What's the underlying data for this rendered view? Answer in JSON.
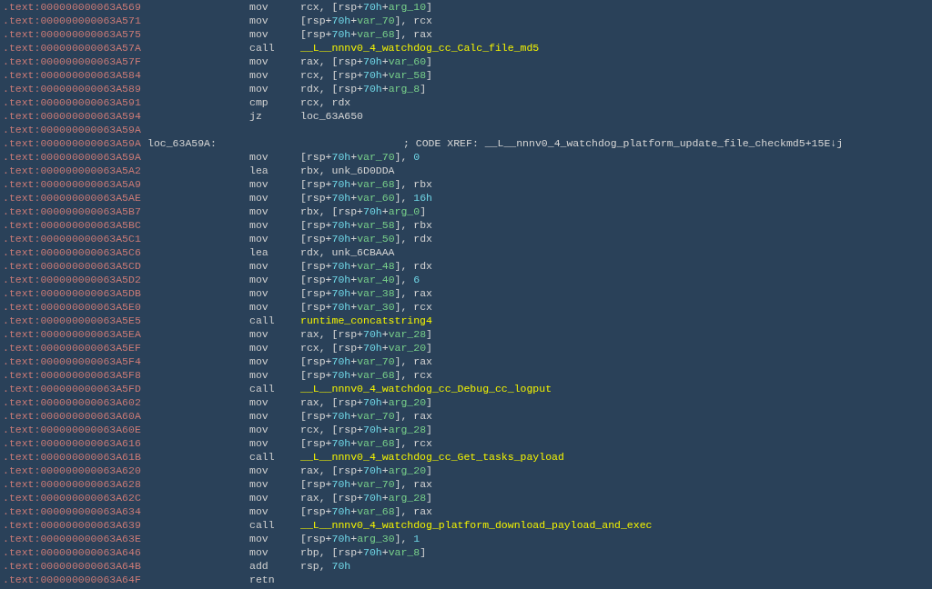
{
  "listing": [
    {
      "address": ".text:000000000063A569",
      "mnemonic": "mov",
      "operand": [
        {
          "kind": "plain",
          "text": "rcx, [rsp+"
        },
        {
          "kind": "number",
          "text": "70h"
        },
        {
          "kind": "plain",
          "text": "+"
        },
        {
          "kind": "variable",
          "text": "arg_10"
        },
        {
          "kind": "plain",
          "text": "]"
        }
      ]
    },
    {
      "address": ".text:000000000063A571",
      "mnemonic": "mov",
      "operand": [
        {
          "kind": "plain",
          "text": "[rsp+"
        },
        {
          "kind": "number",
          "text": "70h"
        },
        {
          "kind": "plain",
          "text": "+"
        },
        {
          "kind": "variable",
          "text": "var_70"
        },
        {
          "kind": "plain",
          "text": "], rcx"
        }
      ]
    },
    {
      "address": ".text:000000000063A575",
      "mnemonic": "mov",
      "operand": [
        {
          "kind": "plain",
          "text": "[rsp+"
        },
        {
          "kind": "number",
          "text": "70h"
        },
        {
          "kind": "plain",
          "text": "+"
        },
        {
          "kind": "variable",
          "text": "var_68"
        },
        {
          "kind": "plain",
          "text": "], rax"
        }
      ]
    },
    {
      "address": ".text:000000000063A57A",
      "mnemonic": "call",
      "operand": [
        {
          "kind": "function",
          "text": "__L__nnnv0_4_watchdog_cc_Calc_file_md5"
        }
      ]
    },
    {
      "address": ".text:000000000063A57F",
      "mnemonic": "mov",
      "operand": [
        {
          "kind": "plain",
          "text": "rax, [rsp+"
        },
        {
          "kind": "number",
          "text": "70h"
        },
        {
          "kind": "plain",
          "text": "+"
        },
        {
          "kind": "variable",
          "text": "var_60"
        },
        {
          "kind": "plain",
          "text": "]"
        }
      ]
    },
    {
      "address": ".text:000000000063A584",
      "mnemonic": "mov",
      "operand": [
        {
          "kind": "plain",
          "text": "rcx, [rsp+"
        },
        {
          "kind": "number",
          "text": "70h"
        },
        {
          "kind": "plain",
          "text": "+"
        },
        {
          "kind": "variable",
          "text": "var_58"
        },
        {
          "kind": "plain",
          "text": "]"
        }
      ]
    },
    {
      "address": ".text:000000000063A589",
      "mnemonic": "mov",
      "operand": [
        {
          "kind": "plain",
          "text": "rdx, [rsp+"
        },
        {
          "kind": "number",
          "text": "70h"
        },
        {
          "kind": "plain",
          "text": "+"
        },
        {
          "kind": "variable",
          "text": "arg_8"
        },
        {
          "kind": "plain",
          "text": "]"
        }
      ]
    },
    {
      "address": ".text:000000000063A591",
      "mnemonic": "cmp",
      "operand": [
        {
          "kind": "plain",
          "text": "rcx, rdx"
        }
      ]
    },
    {
      "address": ".text:000000000063A594",
      "mnemonic": "jz",
      "operand": [
        {
          "kind": "plain",
          "text": "loc_63A650"
        }
      ]
    },
    {
      "address": ".text:000000000063A59A"
    },
    {
      "address": ".text:000000000063A59A",
      "label": "loc_63A59A:",
      "comment": "; CODE XREF: __L__nnnv0_4_watchdog_platform_update_file_checkmd5+15E↓j"
    },
    {
      "address": ".text:000000000063A59A",
      "mnemonic": "mov",
      "operand": [
        {
          "kind": "plain",
          "text": "[rsp+"
        },
        {
          "kind": "number",
          "text": "70h"
        },
        {
          "kind": "plain",
          "text": "+"
        },
        {
          "kind": "variable",
          "text": "var_70"
        },
        {
          "kind": "plain",
          "text": "], "
        },
        {
          "kind": "number",
          "text": "0"
        }
      ]
    },
    {
      "address": ".text:000000000063A5A2",
      "mnemonic": "lea",
      "operand": [
        {
          "kind": "plain",
          "text": "rbx, unk_6D0DDA"
        }
      ]
    },
    {
      "address": ".text:000000000063A5A9",
      "mnemonic": "mov",
      "operand": [
        {
          "kind": "plain",
          "text": "[rsp+"
        },
        {
          "kind": "number",
          "text": "70h"
        },
        {
          "kind": "plain",
          "text": "+"
        },
        {
          "kind": "variable",
          "text": "var_68"
        },
        {
          "kind": "plain",
          "text": "], rbx"
        }
      ]
    },
    {
      "address": ".text:000000000063A5AE",
      "mnemonic": "mov",
      "operand": [
        {
          "kind": "plain",
          "text": "[rsp+"
        },
        {
          "kind": "number",
          "text": "70h"
        },
        {
          "kind": "plain",
          "text": "+"
        },
        {
          "kind": "variable",
          "text": "var_60"
        },
        {
          "kind": "plain",
          "text": "], "
        },
        {
          "kind": "number",
          "text": "16h"
        }
      ]
    },
    {
      "address": ".text:000000000063A5B7",
      "mnemonic": "mov",
      "operand": [
        {
          "kind": "plain",
          "text": "rbx, [rsp+"
        },
        {
          "kind": "number",
          "text": "70h"
        },
        {
          "kind": "plain",
          "text": "+"
        },
        {
          "kind": "variable",
          "text": "arg_0"
        },
        {
          "kind": "plain",
          "text": "]"
        }
      ]
    },
    {
      "address": ".text:000000000063A5BC",
      "mnemonic": "mov",
      "operand": [
        {
          "kind": "plain",
          "text": "[rsp+"
        },
        {
          "kind": "number",
          "text": "70h"
        },
        {
          "kind": "plain",
          "text": "+"
        },
        {
          "kind": "variable",
          "text": "var_58"
        },
        {
          "kind": "plain",
          "text": "], rbx"
        }
      ]
    },
    {
      "address": ".text:000000000063A5C1",
      "mnemonic": "mov",
      "operand": [
        {
          "kind": "plain",
          "text": "[rsp+"
        },
        {
          "kind": "number",
          "text": "70h"
        },
        {
          "kind": "plain",
          "text": "+"
        },
        {
          "kind": "variable",
          "text": "var_50"
        },
        {
          "kind": "plain",
          "text": "], rdx"
        }
      ]
    },
    {
      "address": ".text:000000000063A5C6",
      "mnemonic": "lea",
      "operand": [
        {
          "kind": "plain",
          "text": "rdx, unk_6CBAAA"
        }
      ]
    },
    {
      "address": ".text:000000000063A5CD",
      "mnemonic": "mov",
      "operand": [
        {
          "kind": "plain",
          "text": "[rsp+"
        },
        {
          "kind": "number",
          "text": "70h"
        },
        {
          "kind": "plain",
          "text": "+"
        },
        {
          "kind": "variable",
          "text": "var_48"
        },
        {
          "kind": "plain",
          "text": "], rdx"
        }
      ]
    },
    {
      "address": ".text:000000000063A5D2",
      "mnemonic": "mov",
      "operand": [
        {
          "kind": "plain",
          "text": "[rsp+"
        },
        {
          "kind": "number",
          "text": "70h"
        },
        {
          "kind": "plain",
          "text": "+"
        },
        {
          "kind": "variable",
          "text": "var_40"
        },
        {
          "kind": "plain",
          "text": "], "
        },
        {
          "kind": "number",
          "text": "6"
        }
      ]
    },
    {
      "address": ".text:000000000063A5DB",
      "mnemonic": "mov",
      "operand": [
        {
          "kind": "plain",
          "text": "[rsp+"
        },
        {
          "kind": "number",
          "text": "70h"
        },
        {
          "kind": "plain",
          "text": "+"
        },
        {
          "kind": "variable",
          "text": "var_38"
        },
        {
          "kind": "plain",
          "text": "], rax"
        }
      ]
    },
    {
      "address": ".text:000000000063A5E0",
      "mnemonic": "mov",
      "operand": [
        {
          "kind": "plain",
          "text": "[rsp+"
        },
        {
          "kind": "number",
          "text": "70h"
        },
        {
          "kind": "plain",
          "text": "+"
        },
        {
          "kind": "variable",
          "text": "var_30"
        },
        {
          "kind": "plain",
          "text": "], rcx"
        }
      ]
    },
    {
      "address": ".text:000000000063A5E5",
      "mnemonic": "call",
      "operand": [
        {
          "kind": "function",
          "text": "runtime_concatstring4"
        }
      ]
    },
    {
      "address": ".text:000000000063A5EA",
      "mnemonic": "mov",
      "operand": [
        {
          "kind": "plain",
          "text": "rax, [rsp+"
        },
        {
          "kind": "number",
          "text": "70h"
        },
        {
          "kind": "plain",
          "text": "+"
        },
        {
          "kind": "variable",
          "text": "var_28"
        },
        {
          "kind": "plain",
          "text": "]"
        }
      ]
    },
    {
      "address": ".text:000000000063A5EF",
      "mnemonic": "mov",
      "operand": [
        {
          "kind": "plain",
          "text": "rcx, [rsp+"
        },
        {
          "kind": "number",
          "text": "70h"
        },
        {
          "kind": "plain",
          "text": "+"
        },
        {
          "kind": "variable",
          "text": "var_20"
        },
        {
          "kind": "plain",
          "text": "]"
        }
      ]
    },
    {
      "address": ".text:000000000063A5F4",
      "mnemonic": "mov",
      "operand": [
        {
          "kind": "plain",
          "text": "[rsp+"
        },
        {
          "kind": "number",
          "text": "70h"
        },
        {
          "kind": "plain",
          "text": "+"
        },
        {
          "kind": "variable",
          "text": "var_70"
        },
        {
          "kind": "plain",
          "text": "], rax"
        }
      ]
    },
    {
      "address": ".text:000000000063A5F8",
      "mnemonic": "mov",
      "operand": [
        {
          "kind": "plain",
          "text": "[rsp+"
        },
        {
          "kind": "number",
          "text": "70h"
        },
        {
          "kind": "plain",
          "text": "+"
        },
        {
          "kind": "variable",
          "text": "var_68"
        },
        {
          "kind": "plain",
          "text": "], rcx"
        }
      ]
    },
    {
      "address": ".text:000000000063A5FD",
      "mnemonic": "call",
      "operand": [
        {
          "kind": "function",
          "text": "__L__nnnv0_4_watchdog_cc_Debug_cc_logput"
        }
      ]
    },
    {
      "address": ".text:000000000063A602",
      "mnemonic": "mov",
      "operand": [
        {
          "kind": "plain",
          "text": "rax, [rsp+"
        },
        {
          "kind": "number",
          "text": "70h"
        },
        {
          "kind": "plain",
          "text": "+"
        },
        {
          "kind": "variable",
          "text": "arg_20"
        },
        {
          "kind": "plain",
          "text": "]"
        }
      ]
    },
    {
      "address": ".text:000000000063A60A",
      "mnemonic": "mov",
      "operand": [
        {
          "kind": "plain",
          "text": "[rsp+"
        },
        {
          "kind": "number",
          "text": "70h"
        },
        {
          "kind": "plain",
          "text": "+"
        },
        {
          "kind": "variable",
          "text": "var_70"
        },
        {
          "kind": "plain",
          "text": "], rax"
        }
      ]
    },
    {
      "address": ".text:000000000063A60E",
      "mnemonic": "mov",
      "operand": [
        {
          "kind": "plain",
          "text": "rcx, [rsp+"
        },
        {
          "kind": "number",
          "text": "70h"
        },
        {
          "kind": "plain",
          "text": "+"
        },
        {
          "kind": "variable",
          "text": "arg_28"
        },
        {
          "kind": "plain",
          "text": "]"
        }
      ]
    },
    {
      "address": ".text:000000000063A616",
      "mnemonic": "mov",
      "operand": [
        {
          "kind": "plain",
          "text": "[rsp+"
        },
        {
          "kind": "number",
          "text": "70h"
        },
        {
          "kind": "plain",
          "text": "+"
        },
        {
          "kind": "variable",
          "text": "var_68"
        },
        {
          "kind": "plain",
          "text": "], rcx"
        }
      ]
    },
    {
      "address": ".text:000000000063A61B",
      "mnemonic": "call",
      "operand": [
        {
          "kind": "function",
          "text": "__L__nnnv0_4_watchdog_cc_Get_tasks_payload"
        }
      ]
    },
    {
      "address": ".text:000000000063A620",
      "mnemonic": "mov",
      "operand": [
        {
          "kind": "plain",
          "text": "rax, [rsp+"
        },
        {
          "kind": "number",
          "text": "70h"
        },
        {
          "kind": "plain",
          "text": "+"
        },
        {
          "kind": "variable",
          "text": "arg_20"
        },
        {
          "kind": "plain",
          "text": "]"
        }
      ]
    },
    {
      "address": ".text:000000000063A628",
      "mnemonic": "mov",
      "operand": [
        {
          "kind": "plain",
          "text": "[rsp+"
        },
        {
          "kind": "number",
          "text": "70h"
        },
        {
          "kind": "plain",
          "text": "+"
        },
        {
          "kind": "variable",
          "text": "var_70"
        },
        {
          "kind": "plain",
          "text": "], rax"
        }
      ]
    },
    {
      "address": ".text:000000000063A62C",
      "mnemonic": "mov",
      "operand": [
        {
          "kind": "plain",
          "text": "rax, [rsp+"
        },
        {
          "kind": "number",
          "text": "70h"
        },
        {
          "kind": "plain",
          "text": "+"
        },
        {
          "kind": "variable",
          "text": "arg_28"
        },
        {
          "kind": "plain",
          "text": "]"
        }
      ]
    },
    {
      "address": ".text:000000000063A634",
      "mnemonic": "mov",
      "operand": [
        {
          "kind": "plain",
          "text": "[rsp+"
        },
        {
          "kind": "number",
          "text": "70h"
        },
        {
          "kind": "plain",
          "text": "+"
        },
        {
          "kind": "variable",
          "text": "var_68"
        },
        {
          "kind": "plain",
          "text": "], rax"
        }
      ]
    },
    {
      "address": ".text:000000000063A639",
      "mnemonic": "call",
      "operand": [
        {
          "kind": "function",
          "text": "__L__nnnv0_4_watchdog_platform_download_payload_and_exec"
        }
      ]
    },
    {
      "address": ".text:000000000063A63E",
      "mnemonic": "mov",
      "operand": [
        {
          "kind": "plain",
          "text": "[rsp+"
        },
        {
          "kind": "number",
          "text": "70h"
        },
        {
          "kind": "plain",
          "text": "+"
        },
        {
          "kind": "variable",
          "text": "arg_30"
        },
        {
          "kind": "plain",
          "text": "], "
        },
        {
          "kind": "number",
          "text": "1"
        }
      ]
    },
    {
      "address": ".text:000000000063A646",
      "mnemonic": "mov",
      "operand": [
        {
          "kind": "plain",
          "text": "rbp, [rsp+"
        },
        {
          "kind": "number",
          "text": "70h"
        },
        {
          "kind": "plain",
          "text": "+"
        },
        {
          "kind": "variable",
          "text": "var_8"
        },
        {
          "kind": "plain",
          "text": "]"
        }
      ]
    },
    {
      "address": ".text:000000000063A64B",
      "mnemonic": "add",
      "operand": [
        {
          "kind": "plain",
          "text": "rsp, "
        },
        {
          "kind": "number",
          "text": "70h"
        }
      ]
    },
    {
      "address": ".text:000000000063A64F",
      "mnemonic": "retn"
    }
  ]
}
